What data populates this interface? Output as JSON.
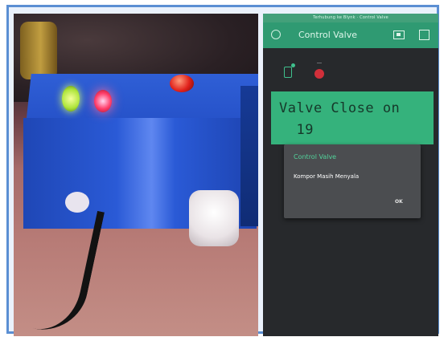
{
  "phone": {
    "statusbar_text": "Terhubung ke Blynk · Control Valve",
    "appbar": {
      "title": "Control Valve"
    },
    "lcd": {
      "line1": "Valve Close on",
      "line2": "19"
    },
    "dialog": {
      "title": "Control Valve",
      "message": "Kompor Masih Menyala",
      "ok_label": "OK"
    }
  },
  "colors": {
    "accent": "#2f9a72",
    "lcd": "#35b27c",
    "led_red": "#d12f3a",
    "frame_border": "#5b8fd3"
  },
  "icons": [
    "back-icon",
    "camera-icon",
    "square-icon",
    "phone-icon",
    "led-icon"
  ]
}
